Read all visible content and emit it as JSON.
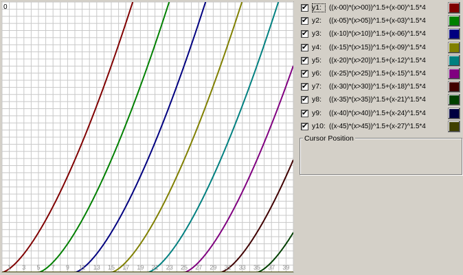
{
  "plot": {
    "y_axis_label": "0",
    "x_ticks": [
      "1",
      "3",
      "5",
      "7",
      "9",
      "11",
      "13",
      "15",
      "17",
      "19",
      "21",
      "23",
      "25",
      "27",
      "29",
      "31",
      "33",
      "35",
      "37",
      "39"
    ],
    "grid_color": "#c8c8c8",
    "background": "#ffffff"
  },
  "chart_data": {
    "type": "line",
    "title": "",
    "xlabel": "",
    "ylabel": "",
    "xlim": [
      0,
      40
    ],
    "ylim": [
      0,
      380
    ],
    "grid": true,
    "series": [
      {
        "name": "y1",
        "shift": 0,
        "color": "#800000"
      },
      {
        "name": "y2",
        "shift": 5,
        "color": "#008000"
      },
      {
        "name": "y3",
        "shift": 10,
        "color": "#000080"
      },
      {
        "name": "y4",
        "shift": 15,
        "color": "#808000"
      },
      {
        "name": "y5",
        "shift": 20,
        "color": "#008080"
      },
      {
        "name": "y6",
        "shift": 25,
        "color": "#800080"
      },
      {
        "name": "y7",
        "shift": 30,
        "color": "#400000"
      },
      {
        "name": "y8",
        "shift": 35,
        "color": "#004000"
      },
      {
        "name": "y9",
        "shift": 40,
        "color": "#000040"
      },
      {
        "name": "y10",
        "shift": 45,
        "color": "#404000"
      }
    ]
  },
  "functions": [
    {
      "label": "y1:",
      "expr": "((x-00)*(x>00))^1.5+(x-00)^1.5*4",
      "checked": true,
      "color": "#800000"
    },
    {
      "label": "y2:",
      "expr": "((x-05)*(x>05))^1.5+(x-03)^1.5*4",
      "checked": true,
      "color": "#008000"
    },
    {
      "label": "y3:",
      "expr": "((x-10)*(x>10))^1.5+(x-06)^1.5*4",
      "checked": true,
      "color": "#000080"
    },
    {
      "label": "y4:",
      "expr": "((x-15)*(x>15))^1.5+(x-09)^1.5*4",
      "checked": true,
      "color": "#808000"
    },
    {
      "label": "y5:",
      "expr": "((x-20)*(x>20))^1.5+(x-12)^1.5*4",
      "checked": true,
      "color": "#008080"
    },
    {
      "label": "y6:",
      "expr": "((x-25)*(x>25))^1.5+(x-15)^1.5*4",
      "checked": true,
      "color": "#800080"
    },
    {
      "label": "y7:",
      "expr": "((x-30)*(x>30))^1.5+(x-18)^1.5*4",
      "checked": true,
      "color": "#400000"
    },
    {
      "label": "y8:",
      "expr": "((x-35)*(x>35))^1.5+(x-21)^1.5*4",
      "checked": true,
      "color": "#004000"
    },
    {
      "label": "y9:",
      "expr": "((x-40)*(x>40))^1.5+(x-24)^1.5*4",
      "checked": true,
      "color": "#000040"
    },
    {
      "label": "y10:",
      "expr": "((x-45)*(x>45))^1.5+(x-27)^1.5*4",
      "checked": true,
      "color": "#404000"
    }
  ],
  "cursor_position": {
    "title": "Cursor Position",
    "value": ""
  }
}
